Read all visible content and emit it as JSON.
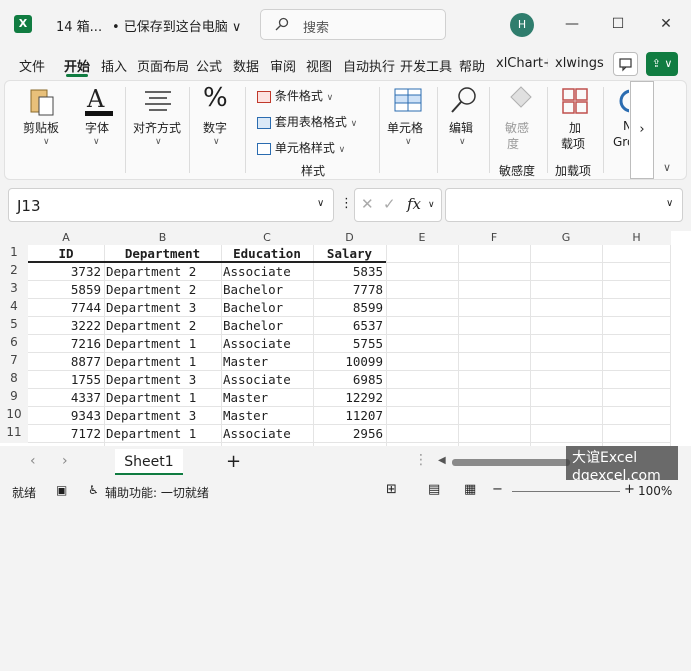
{
  "titlebar": {
    "app_icon": "excel-icon",
    "doc_name": "14 箱...",
    "save_status": "• 已保存到这台电脑 ∨",
    "search_placeholder": "搜索",
    "avatar_letter": "H",
    "minimize": "—",
    "maximize": "☐",
    "close": "✕"
  },
  "menu": {
    "tabs": [
      "文件",
      "开始",
      "插入",
      "页面布局",
      "公式",
      "数据",
      "审阅",
      "视图",
      "自动执行",
      "开发工具",
      "帮助",
      "xlChart+",
      "xlwings"
    ],
    "active": "开始"
  },
  "ribbon": {
    "clipboard": "剪贴板",
    "font": "字体",
    "alignment": "对齐方式",
    "number": "数字",
    "conditional_format": "条件格式",
    "format_as_table": "套用表格格式",
    "cell_styles": "单元格样式",
    "styles_group": "样式",
    "cells": "单元格",
    "editing": "编辑",
    "sensitivity_btn_line1": "敏感",
    "sensitivity_btn_line2": "度",
    "sensitivity_group": "敏感度",
    "addins_btn_line1": "加",
    "addins_btn_line2": "载项",
    "addins_group": "加载项",
    "partial_btn_line1": "N",
    "partial_btn_line2": "Gro"
  },
  "formula_bar": {
    "cell_ref": "J13",
    "fx": "fx"
  },
  "grid": {
    "columns": [
      "A",
      "B",
      "C",
      "D",
      "E",
      "F",
      "G",
      "H"
    ],
    "rows": [
      "1",
      "2",
      "3",
      "4",
      "5",
      "6",
      "7",
      "8",
      "9",
      "10",
      "11"
    ],
    "header": [
      "ID",
      "Department",
      "Education",
      "Salary"
    ],
    "data": [
      [
        "3732",
        "Department 2",
        "Associate",
        "5835"
      ],
      [
        "5859",
        "Department 2",
        "Bachelor",
        "7778"
      ],
      [
        "7744",
        "Department 3",
        "Bachelor",
        "8599"
      ],
      [
        "3222",
        "Department 2",
        "Bachelor",
        "6537"
      ],
      [
        "7216",
        "Department 1",
        "Associate",
        "5755"
      ],
      [
        "8877",
        "Department 1",
        "Master",
        "10099"
      ],
      [
        "1755",
        "Department 3",
        "Associate",
        "6985"
      ],
      [
        "4337",
        "Department 1",
        "Master",
        "12292"
      ],
      [
        "9343",
        "Department 3",
        "Master",
        "11207"
      ],
      [
        "7172",
        "Department 1",
        "Associate",
        "2956"
      ]
    ]
  },
  "sheets": {
    "active": "Sheet1",
    "add": "+"
  },
  "status": {
    "ready": "就绪",
    "accessibility": "辅助功能: 一切就绪",
    "zoom": "100%"
  },
  "watermark": {
    "line1": "大谊Excel",
    "line2": "dqexcel.com"
  },
  "colors": {
    "accent": "#107c41",
    "background": "#f3f3f3"
  }
}
